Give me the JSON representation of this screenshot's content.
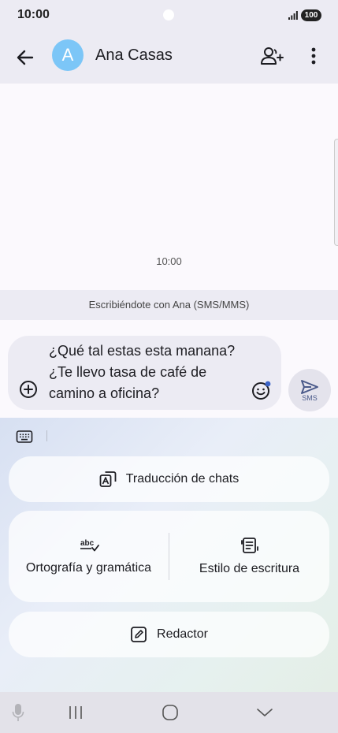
{
  "status_bar": {
    "time": "10:00",
    "battery": "100"
  },
  "header": {
    "avatar_letter": "A",
    "contact_name": "Ana Casas"
  },
  "chat": {
    "timestamp": "10:00"
  },
  "writing_with": "Escribiéndote con Ana (SMS/MMS)",
  "composer": {
    "lines": [
      "¿Qué tal estas esta manana?",
      "¿Te llevo tasa de café de",
      "camino a oficina?"
    ],
    "send_label": "SMS"
  },
  "ai_tools": {
    "translate_label": "Traducción de chats",
    "spelling_label": "Ortografía y gramática",
    "style_label": "Estilo de escritura",
    "writer_label": "Redactor"
  },
  "colors": {
    "avatar": "#7cc6f7",
    "send_icon": "#4a5a8a"
  }
}
